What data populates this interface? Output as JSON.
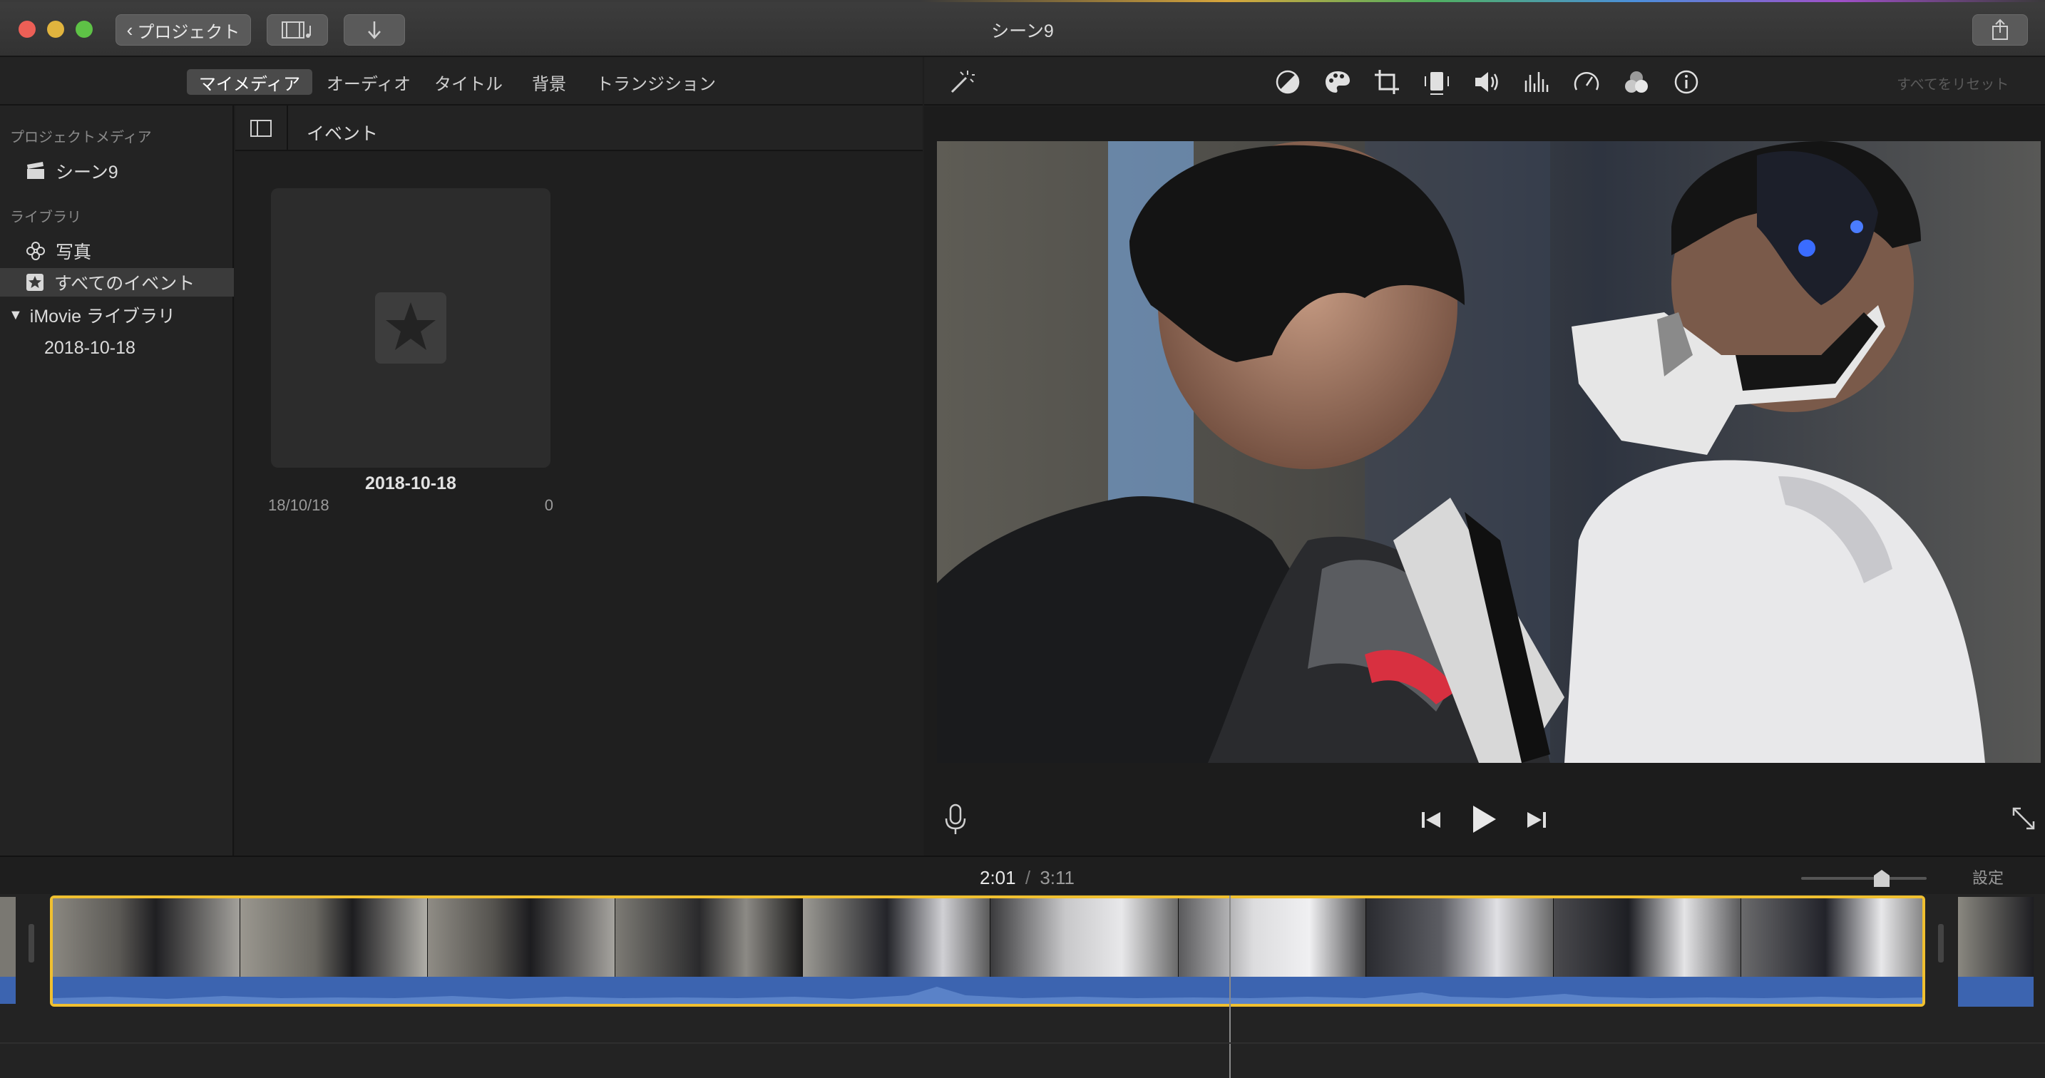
{
  "window": {
    "title": "シーン9",
    "back_button": "プロジェクト"
  },
  "tabs": [
    {
      "label": "マイメディア",
      "active": true
    },
    {
      "label": "オーディオ",
      "active": false
    },
    {
      "label": "タイトル",
      "active": false
    },
    {
      "label": "背景",
      "active": false
    },
    {
      "label": "トランジション",
      "active": false
    }
  ],
  "inspector": {
    "reset_all": "すべてをリセット",
    "tools": [
      "magic-wand-icon",
      "color-balance-icon",
      "color-palette-icon",
      "crop-icon",
      "stabilization-icon",
      "volume-icon",
      "equalizer-icon",
      "speed-icon",
      "clip-filter-icon",
      "info-icon"
    ]
  },
  "sidebar": {
    "project_media_header": "プロジェクトメディア",
    "project_item": "シーン9",
    "library_header": "ライブラリ",
    "photos_item": "写真",
    "all_events_item": "すべてのイベント",
    "imovie_library": "iMovie ライブラリ",
    "event_date_item": "2018-10-18"
  },
  "browser": {
    "header_label": "イベント",
    "event": {
      "title": "2018-10-18",
      "date": "18/10/18",
      "count": "0"
    }
  },
  "timeline": {
    "current_time": "2:01",
    "separator": "/",
    "total_time": "3:11",
    "settings_label": "設定",
    "zoom_level": 0.6
  },
  "colors": {
    "accent_selection": "#f0c030",
    "audio_track": "#3c64b0",
    "background": "#1e1e1e"
  }
}
